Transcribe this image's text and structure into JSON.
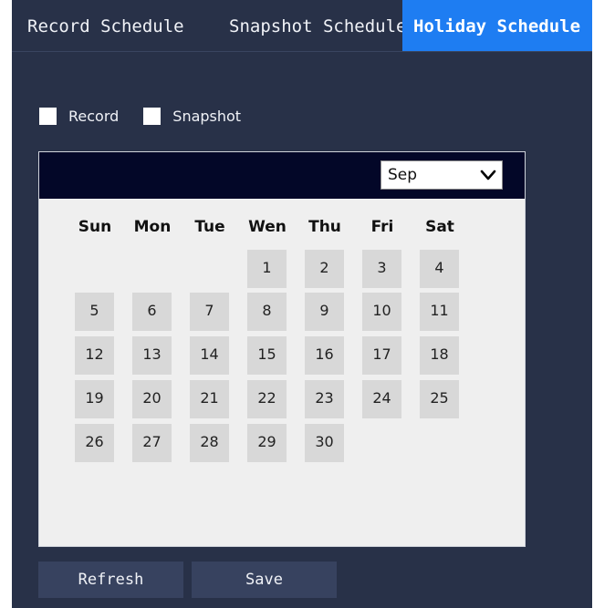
{
  "tabs": [
    {
      "label": "Record Schedule",
      "active": false
    },
    {
      "label": "Snapshot Schedule",
      "active": false
    },
    {
      "label": "Holiday Schedule",
      "active": true
    }
  ],
  "checkboxes": {
    "record_label": "Record",
    "snapshot_label": "Snapshot"
  },
  "calendar": {
    "month_selected": "Sep",
    "weekdays": [
      "Sun",
      "Mon",
      "Tue",
      "Wen",
      "Thu",
      "Fri",
      "Sat"
    ],
    "first_weekday_index": 3,
    "days_in_month": 30
  },
  "buttons": {
    "refresh_label": "Refresh",
    "save_label": "Save"
  },
  "colors": {
    "background": "#283148",
    "active_tab": "#1e7df2",
    "calendar_header": "#030728",
    "day_cell": "#d8d8d8",
    "button": "#37425f"
  },
  "icons": {
    "dropdown": "chevron-down-icon"
  }
}
